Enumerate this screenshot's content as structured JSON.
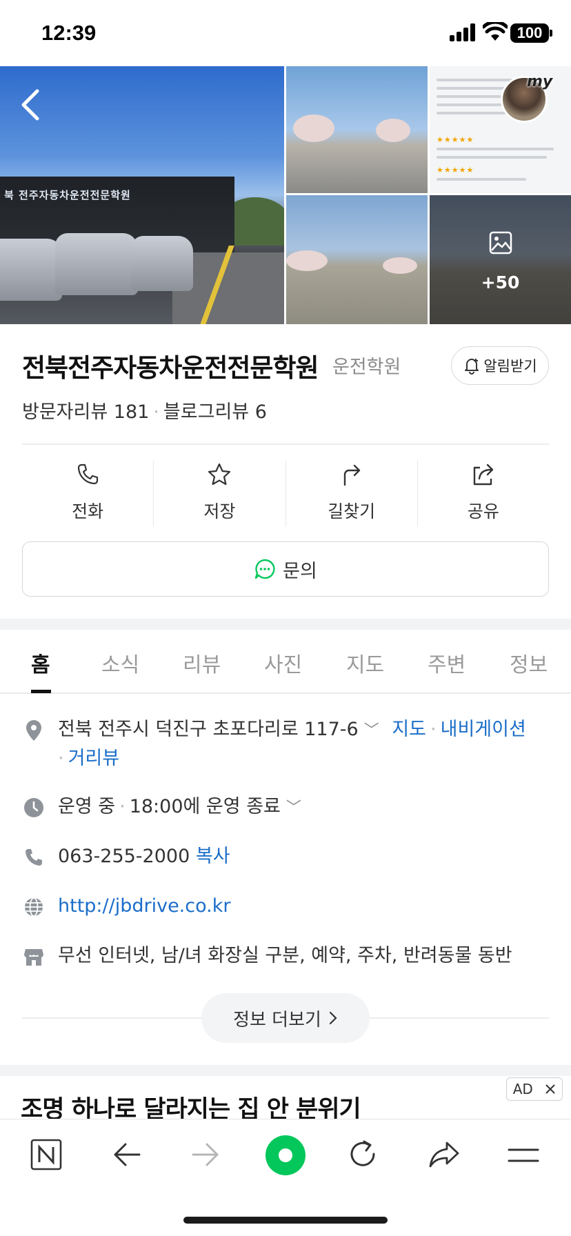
{
  "status_bar": {
    "time": "12:39",
    "battery": "100"
  },
  "gallery": {
    "more_photos_label": "+50",
    "avatar_badge": "my",
    "building_sign": "북 전주자동차운전전문학원"
  },
  "place": {
    "name": "전북전주자동차운전전문학원",
    "category": "운전학원",
    "alarm_label": "알림받기",
    "visitor_reviews_label": "방문자리뷰 181",
    "blog_reviews_label": "블로그리뷰 6"
  },
  "actions": [
    {
      "label": "전화",
      "icon": "phone-icon"
    },
    {
      "label": "저장",
      "icon": "star-icon"
    },
    {
      "label": "길찾기",
      "icon": "directions-icon"
    },
    {
      "label": "공유",
      "icon": "share-icon"
    }
  ],
  "inquiry_label": "문의",
  "tabs": [
    "홈",
    "소식",
    "리뷰",
    "사진",
    "지도",
    "주변",
    "정보"
  ],
  "info": {
    "address": "전북 전주시 덕진구 초포다리로 117-6",
    "map_link": "지도",
    "navigation_link": "내비게이션",
    "street_view_link": "거리뷰",
    "hours_status": "운영 중",
    "hours_detail": "18:00에 운영 종료",
    "phone": "063-255-2000",
    "copy_label": "복사",
    "website": "http://jbdrive.co.kr",
    "amenities": "무선 인터넷, 남/녀 화장실 구분, 예약, 주차, 반려동물 동반"
  },
  "more_info_label": "정보 더보기",
  "ad": {
    "title": "조명 하나로 달라지는 집 안 분위기",
    "badge": "AD"
  },
  "colors": {
    "link": "#1a6dc8",
    "accent_green": "#03c75a"
  }
}
